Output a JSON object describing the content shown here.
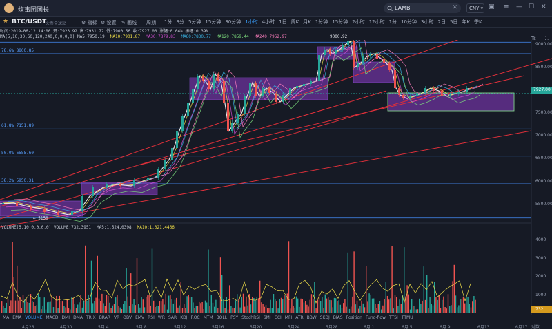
{
  "app": {
    "title": "炊事团团长"
  },
  "search": {
    "value": "LAMB"
  },
  "currency": {
    "value": "CNY"
  },
  "pair": {
    "symbol": "BTC/USDT",
    "exchange": "火币全球站"
  },
  "toolbar": {
    "indicator_label": "指标",
    "settings_label": "设置",
    "draw_label": "画线",
    "period_label": "周期"
  },
  "periods": [
    "1分",
    "3分",
    "5分钟",
    "15分钟",
    "30分钟",
    "1小时",
    "4小时",
    "1日",
    "周K",
    "月K",
    "1分钟",
    "15分钟",
    "2小时",
    "12小时",
    "1分",
    "10分钟",
    "3小时",
    "2日",
    "5日",
    "年K",
    "季K"
  ],
  "active_period": "1小时",
  "info": "时间:2019-06-12 14:00  开:7923.92  高:7931.72  低:7900.56  收:7927.00  涨幅:0.04%  振幅:0.39%",
  "ma": {
    "params": "MA(5,10,30,60,120,240,0,0,0,0)",
    "items": [
      {
        "text": "MA5:7950.19",
        "color": "#c9cfdb"
      },
      {
        "text": "MA10:7901.87",
        "color": "#f2e14a"
      },
      {
        "text": "MA30:7879.83",
        "color": "#d14fd1"
      },
      {
        "text": "MA60:7830.77",
        "color": "#3ab5e6"
      },
      {
        "text": "MA120:7859.44",
        "color": "#7fe07f"
      },
      {
        "text": "MA240:7962.97",
        "color": "#ff7fbf"
      }
    ]
  },
  "fib_levels": [
    {
      "label": "78.6% 8800.85",
      "price": 8800.85
    },
    {
      "label": "61.8% 7151.89",
      "price": 7151.89
    },
    {
      "label": "50.0% 6555.60",
      "price": 6555.6
    },
    {
      "label": "38.2% 5950.31",
      "price": 5950.31
    }
  ],
  "price_axis": {
    "ticks": [
      "9000.00",
      "8500.00",
      "8000.00",
      "7500.00",
      "7000.00",
      "6500.00",
      "6000.00",
      "5500.00"
    ],
    "current": "7927.00"
  },
  "annotations": {
    "high": "9000.92",
    "low": "5150"
  },
  "volume": {
    "params": "VOLUME(5,10,0,0,0,0)",
    "items": [
      {
        "text": "VOLUME:732.3951",
        "color": "#c9cfdb"
      },
      {
        "text": "MA5:1,524.0398",
        "color": "#c9cfdb"
      },
      {
        "text": "MA10:1,021.4466",
        "color": "#f2e14a"
      }
    ],
    "ticks": [
      "4000",
      "3000",
      "2000",
      "1000"
    ],
    "current": "732"
  },
  "indicators": [
    "MA",
    "EMA",
    "VOLUME",
    "MACD",
    "DMI",
    "DMA",
    "TRIX",
    "BRAR",
    "VR",
    "OBV",
    "EMV",
    "RSI",
    "WR",
    "SAR",
    "KDJ",
    "ROC",
    "MTM",
    "BOLL",
    "PSY",
    "StochRSI",
    "SMI",
    "CCI",
    "MFI",
    "ATR",
    "BBW",
    "SKDJ",
    "BIAS",
    "Position",
    "Fund-flow",
    "TTSI",
    "TTMU"
  ],
  "active_indicator": "VOLUME",
  "dates": [
    "4月26",
    "4月30",
    "5月 4",
    "5月 8",
    "5月12",
    "5月16",
    "5月20",
    "5月24",
    "5月28",
    "6月 1",
    "6月 5",
    "6月 9",
    "6月13",
    "6月17"
  ],
  "axis_units": "对数"
}
